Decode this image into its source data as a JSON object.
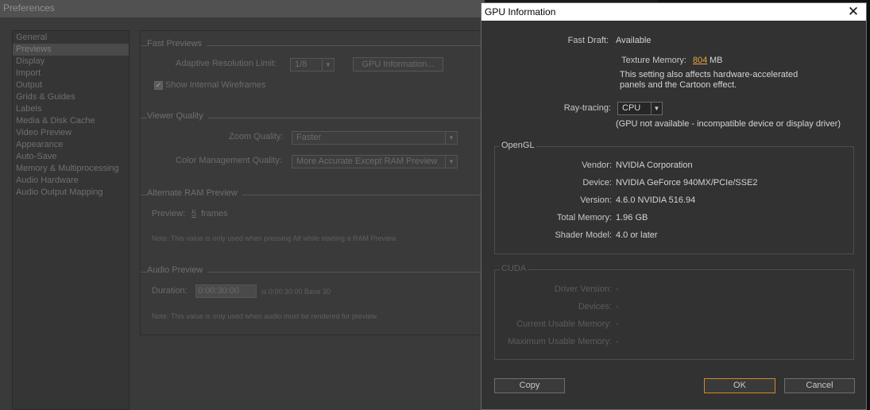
{
  "preferences": {
    "title": "Preferences",
    "categories": [
      "General",
      "Previews",
      "Display",
      "Import",
      "Output",
      "Grids & Guides",
      "Labels",
      "Media & Disk Cache",
      "Video Preview",
      "Appearance",
      "Auto-Save",
      "Memory & Multiprocessing",
      "Audio Hardware",
      "Audio Output Mapping"
    ],
    "selected_category": "Previews",
    "fast_previews": {
      "title": "Fast Previews",
      "adaptive_label": "Adaptive Resolution Limit:",
      "adaptive_value": "1/8",
      "gpu_info_button": "GPU Information...",
      "show_wireframes_label": "Show Internal Wireframes",
      "show_wireframes_checked": true
    },
    "viewer_quality": {
      "title": "Viewer Quality",
      "zoom_label": "Zoom Quality:",
      "zoom_value": "Faster",
      "color_label": "Color Management Quality:",
      "color_value": "More Accurate Except RAM Preview"
    },
    "alternate_ram": {
      "title": "Alternate RAM Preview",
      "preview_label": "Preview:",
      "preview_value": "5",
      "preview_unit": "frames",
      "note": "Note: This value is only used when pressing Alt while starting a RAM Preview."
    },
    "audio_preview": {
      "title": "Audio Preview",
      "duration_label": "Duration:",
      "duration_value": "0:00:30:00",
      "duration_info": "is 0:00:30:00  Base 30",
      "note": "Note: This value is only used when audio must be rendered for preview."
    }
  },
  "gpu_dialog": {
    "title": "GPU Information",
    "fast_draft_label": "Fast Draft:",
    "fast_draft_value": "Available",
    "texture_memory_label": "Texture Memory:",
    "texture_memory_value": "804",
    "texture_memory_unit": "MB",
    "texture_note_1": "This setting also affects hardware-accelerated",
    "texture_note_2": "panels and the Cartoon effect.",
    "raytracing_label": "Ray-tracing:",
    "raytracing_value": "CPU",
    "raytracing_note": "(GPU not available - incompatible device or display driver)",
    "opengl": {
      "title": "OpenGL",
      "rows": [
        {
          "label": "Vendor:",
          "value": "NVIDIA Corporation"
        },
        {
          "label": "Device:",
          "value": "NVIDIA GeForce 940MX/PCIe/SSE2"
        },
        {
          "label": "Version:",
          "value": "4.6.0 NVIDIA 516.94"
        },
        {
          "label": "Total Memory:",
          "value": "1.96 GB"
        },
        {
          "label": "Shader Model:",
          "value": "4.0 or later"
        }
      ]
    },
    "cuda": {
      "title": "CUDA",
      "rows": [
        {
          "label": "Driver Version:",
          "value": "-"
        },
        {
          "label": "Devices:",
          "value": "-"
        },
        {
          "label": "Current Usable Memory:",
          "value": "-"
        },
        {
          "label": "Maximum Usable Memory:",
          "value": "-"
        }
      ]
    },
    "buttons": {
      "copy": "Copy",
      "ok": "OK",
      "cancel": "Cancel"
    },
    "colors": {
      "accent": "#e8a640",
      "primary_border": "#d08a28"
    },
    "icons": {
      "close": "close-icon"
    }
  }
}
